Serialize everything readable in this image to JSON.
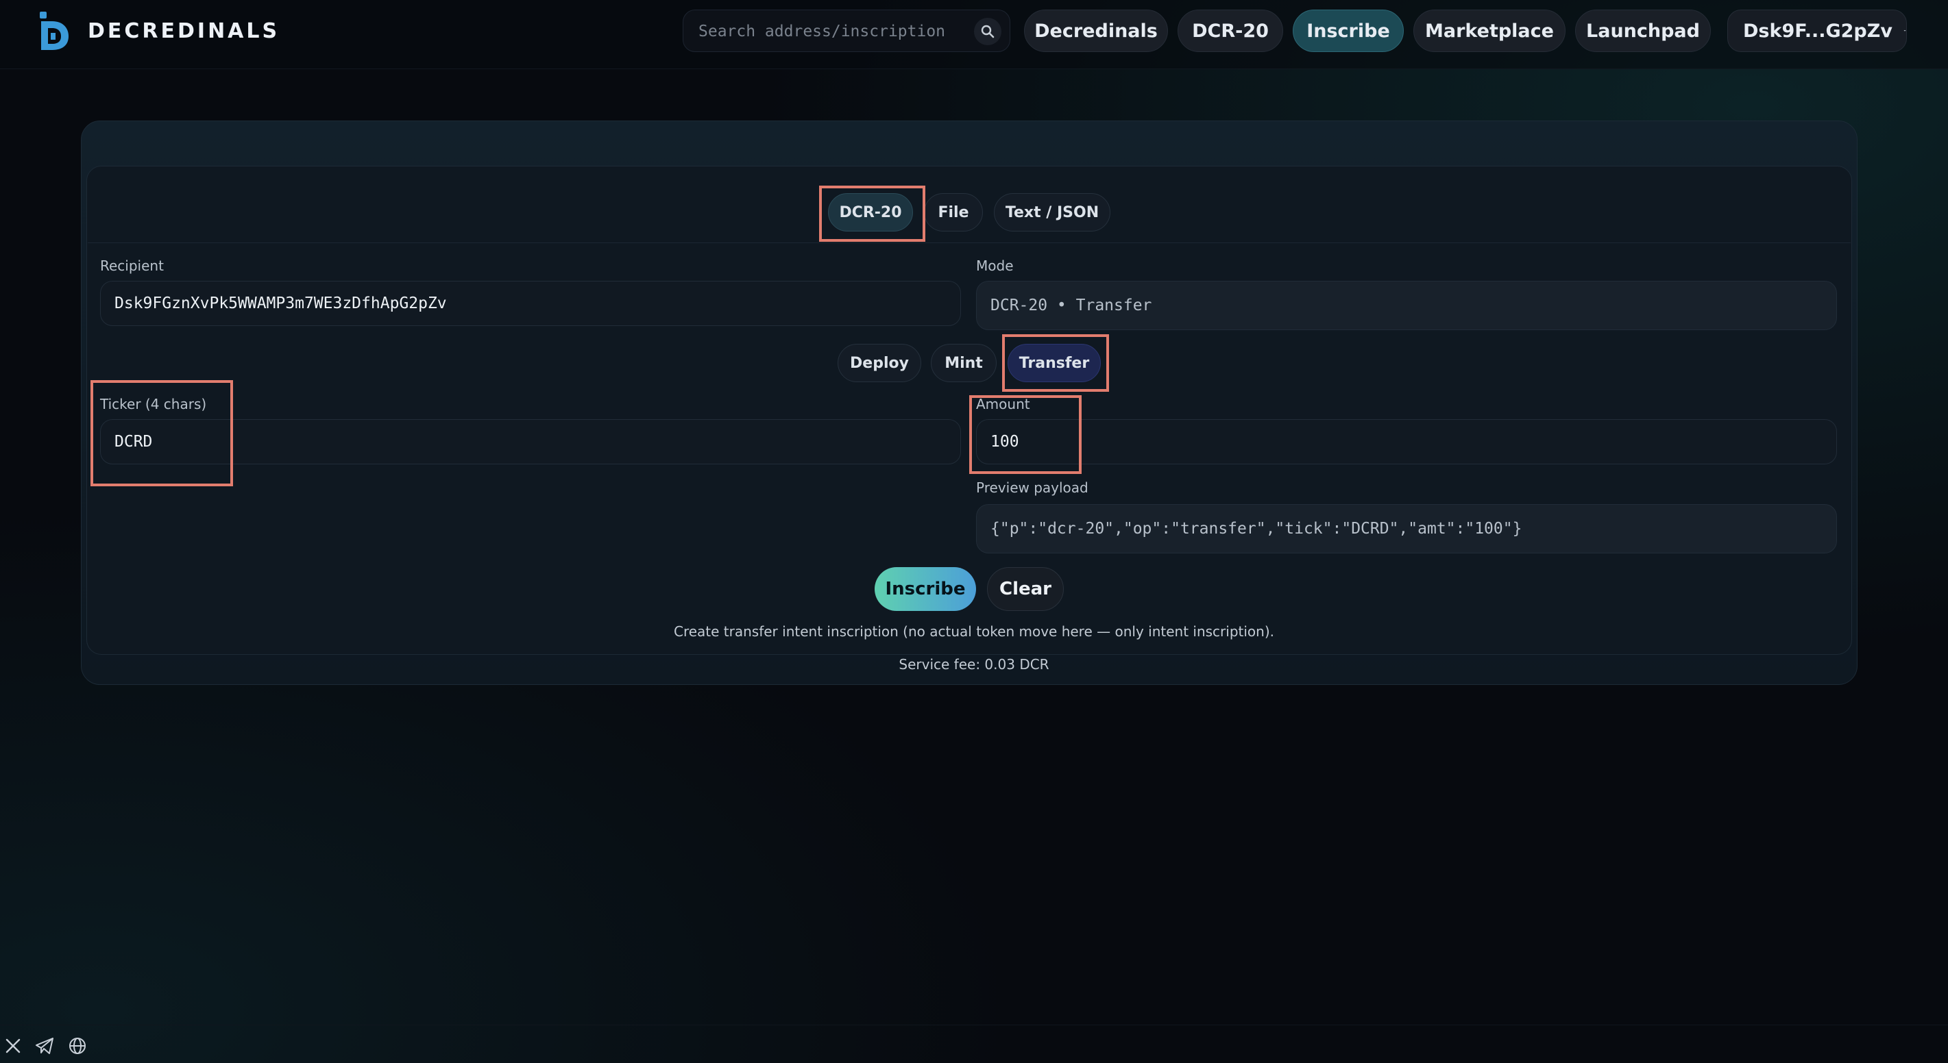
{
  "header": {
    "brand": "DECREDINALS",
    "search": {
      "placeholder": "Search address/inscription"
    },
    "nav": [
      "Decredinals",
      "DCR-20",
      "Inscribe",
      "Marketplace",
      "Launchpad"
    ],
    "active_nav": "Inscribe",
    "wallet": "Dsk9F...G2pZv"
  },
  "inscribe": {
    "tabs": [
      "DCR-20",
      "File",
      "Text / JSON"
    ],
    "active_tab": "DCR-20",
    "recipient": {
      "label": "Recipient",
      "value": "Dsk9FGznXvPk5WWAMP3m7WE3zDfhApG2pZv"
    },
    "mode": {
      "label": "Mode",
      "value": "DCR-20 • Transfer"
    },
    "ops": [
      "Deploy",
      "Mint",
      "Transfer"
    ],
    "active_op": "Transfer",
    "ticker": {
      "label": "Ticker (4 chars)",
      "value": "DCRD"
    },
    "amount": {
      "label": "Amount",
      "value": "100"
    },
    "preview": {
      "label": "Preview payload",
      "value": "{\"p\":\"dcr-20\",\"op\":\"transfer\",\"tick\":\"DCRD\",\"amt\":\"100\"}"
    },
    "buttons": {
      "inscribe": "Inscribe",
      "clear": "Clear"
    },
    "note": "Create transfer intent inscription (no actual token move here — only intent inscription).",
    "service_fee": "Service fee: 0.03 DCR"
  },
  "footer": {
    "icons": [
      "x-icon",
      "telegram-icon",
      "globe-icon"
    ]
  },
  "colors": {
    "accent": "#4fb8c8",
    "highlight": "#e27d6e",
    "background": "#070a0f"
  }
}
